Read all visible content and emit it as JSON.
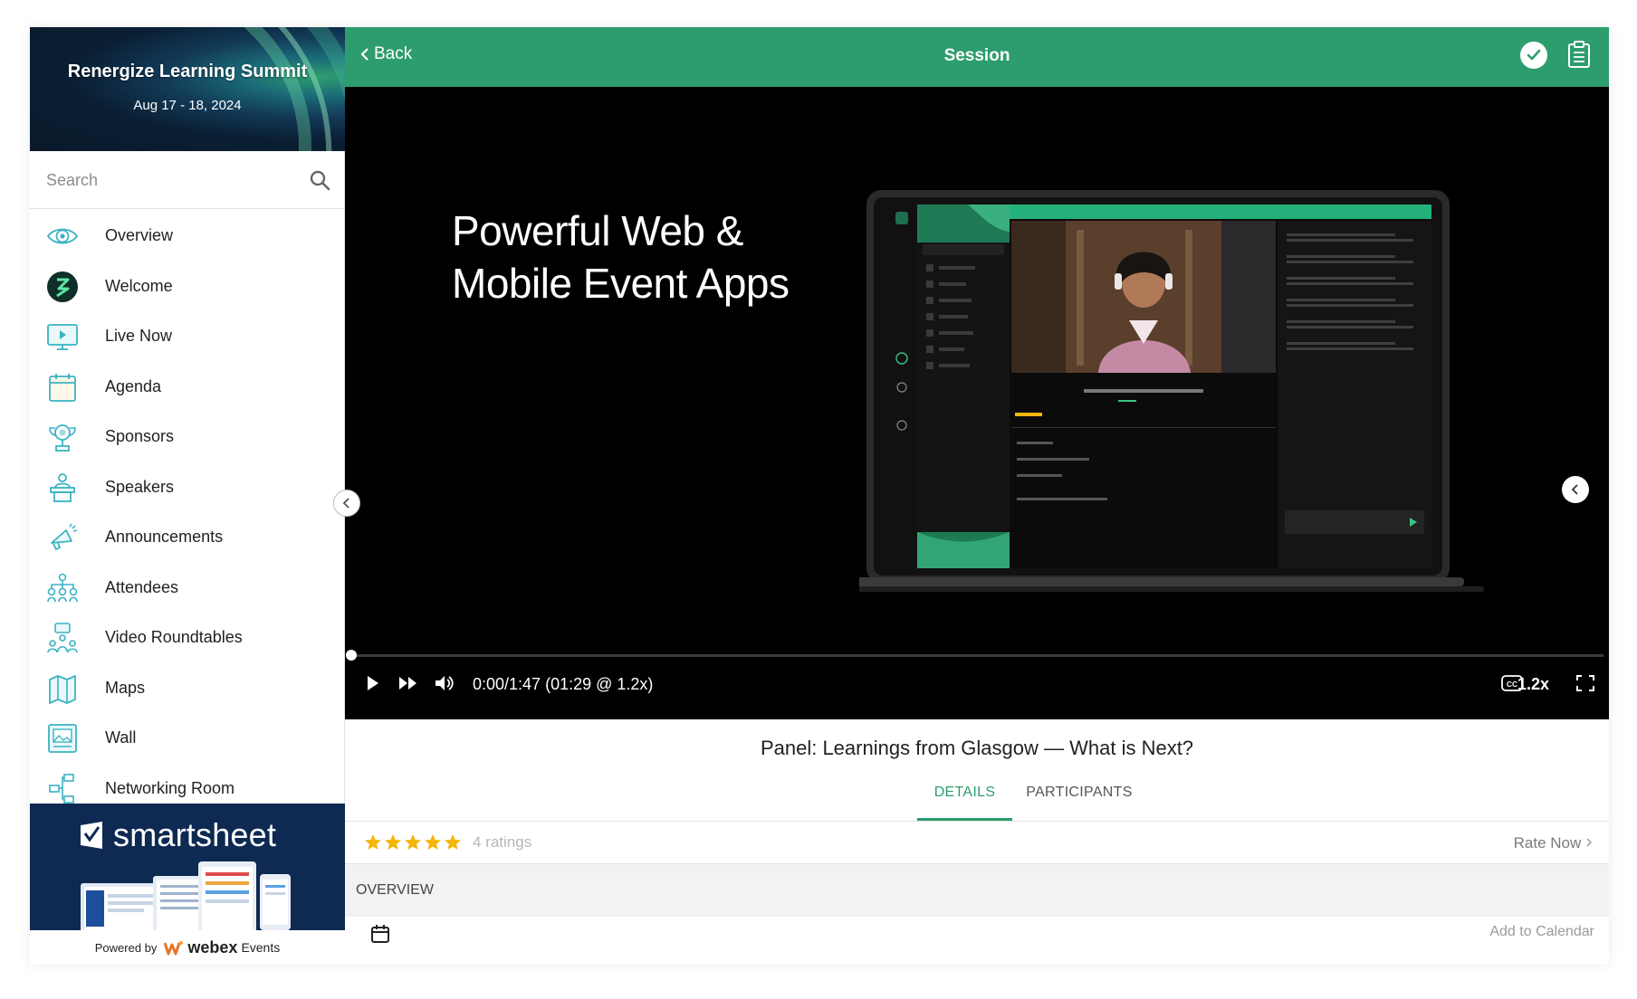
{
  "sidebar": {
    "event_title": "Renergize Learning Summit",
    "event_dates": "Aug 17 - 18, 2024",
    "search_placeholder": "Search",
    "items": [
      {
        "label": "Overview",
        "icon": "eye-icon"
      },
      {
        "label": "Welcome",
        "icon": "welcome-logo-icon"
      },
      {
        "label": "Live Now",
        "icon": "monitor-play-icon"
      },
      {
        "label": "Agenda",
        "icon": "calendar-icon"
      },
      {
        "label": "Sponsors",
        "icon": "trophy-icon"
      },
      {
        "label": "Speakers",
        "icon": "podium-speaker-icon"
      },
      {
        "label": "Announcements",
        "icon": "megaphone-icon"
      },
      {
        "label": "Attendees",
        "icon": "people-network-icon"
      },
      {
        "label": "Video Roundtables",
        "icon": "roundtable-icon"
      },
      {
        "label": "Maps",
        "icon": "map-icon"
      },
      {
        "label": "Wall",
        "icon": "photo-wall-icon"
      },
      {
        "label": "Networking Room",
        "icon": "networking-icon"
      }
    ],
    "ad": {
      "brand": "smartsheet"
    },
    "powered": {
      "prefix": "Powered by",
      "brand": "webex",
      "suffix": "Events"
    }
  },
  "topbar": {
    "back_label": "Back",
    "title": "Session"
  },
  "video": {
    "headline": "Powerful Web & Mobile Event Apps",
    "time": "0:00/1:47 (01:29 @ 1.2x)",
    "speed": "1.2x",
    "progress": 0
  },
  "session": {
    "title": "Panel: Learnings from Glasgow — What is Next?",
    "tabs": [
      "DETAILS",
      "PARTICIPANTS"
    ],
    "active_tab": "DETAILS",
    "rating_stars": 5,
    "ratings_count": "4 ratings",
    "rate_now": "Rate Now",
    "overview_label": "OVERVIEW",
    "add_calendar": "Add to Calendar"
  },
  "colors": {
    "accent": "#2e9d6e",
    "star": "#f5b50a",
    "icon_teal": "#3bb3c3"
  }
}
